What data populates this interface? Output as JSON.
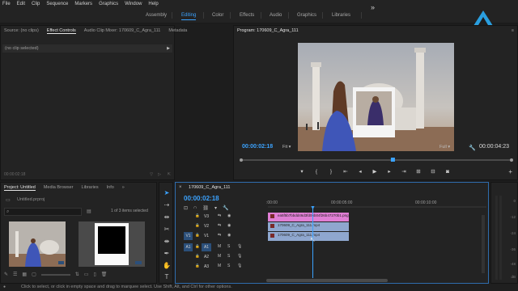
{
  "menu": [
    "File",
    "Edit",
    "Clip",
    "Sequence",
    "Markers",
    "Graphics",
    "Window",
    "Help"
  ],
  "workspaces": [
    "Assembly",
    "Editing",
    "Color",
    "Effects",
    "Audio",
    "Graphics",
    "Libraries"
  ],
  "workspace_active": "Editing",
  "more_icon": "chevron-double-right-icon",
  "brand_color": "#3ba3ff",
  "source_panel": {
    "tabs": [
      "Source: (no clips)",
      "Effect Controls",
      "Audio Clip Mixer: 170609_C_Agra_111",
      "Metadata"
    ],
    "active_tab": "Effect Controls",
    "dropdown_value": "(no clip selected)",
    "timecode": "00:00:02:18"
  },
  "program_panel": {
    "title": "Program: 170609_C_Agra_111",
    "timecode_current": "00:00:02:18",
    "timecode_duration": "00:00:04:23",
    "zoom": "Fit",
    "resolution": "Full",
    "playhead_fraction": 0.56
  },
  "project_panel": {
    "tabs": [
      "Project: Untitled",
      "Media Browser",
      "Libraries",
      "Info"
    ],
    "more": "»",
    "file": "Untitled.prproj",
    "items_count": "1 of 3 items selected"
  },
  "timeline": {
    "sequence_tab": "170609_C_Agra_111",
    "timecode": "00:00:02:18",
    "ruler": [
      ":00:00",
      "00:00:05:00",
      "00:00:10:00"
    ],
    "tracks": [
      {
        "id": "V3",
        "source": "",
        "kind": "video"
      },
      {
        "id": "V2",
        "source": "",
        "kind": "video"
      },
      {
        "id": "V1",
        "source": "V1",
        "kind": "video"
      },
      {
        "id": "A1",
        "source": "A1",
        "kind": "audio"
      },
      {
        "id": "A2",
        "source": "",
        "kind": "audio"
      },
      {
        "id": "A3",
        "source": "",
        "kind": "audio"
      }
    ],
    "clips": [
      {
        "track": "V3",
        "label": "ea5f5b7bbdd46d3fd06b04f26b47270b1.png",
        "color": "#e07ed4"
      },
      {
        "track": "V2",
        "label": "170609_C_Agra_111.mp4",
        "color": "#8fa7cf"
      },
      {
        "track": "V1",
        "label": "170609_C_Agra_111.mp4",
        "color": "#8fa7cf"
      }
    ]
  },
  "meter": {
    "labels": [
      "0",
      "-12",
      "-24",
      "-36",
      "-48",
      "dB"
    ]
  },
  "status": "Click to select, or click in empty space and drag to marquee select. Use Shift, Alt, and Ctrl for other options."
}
